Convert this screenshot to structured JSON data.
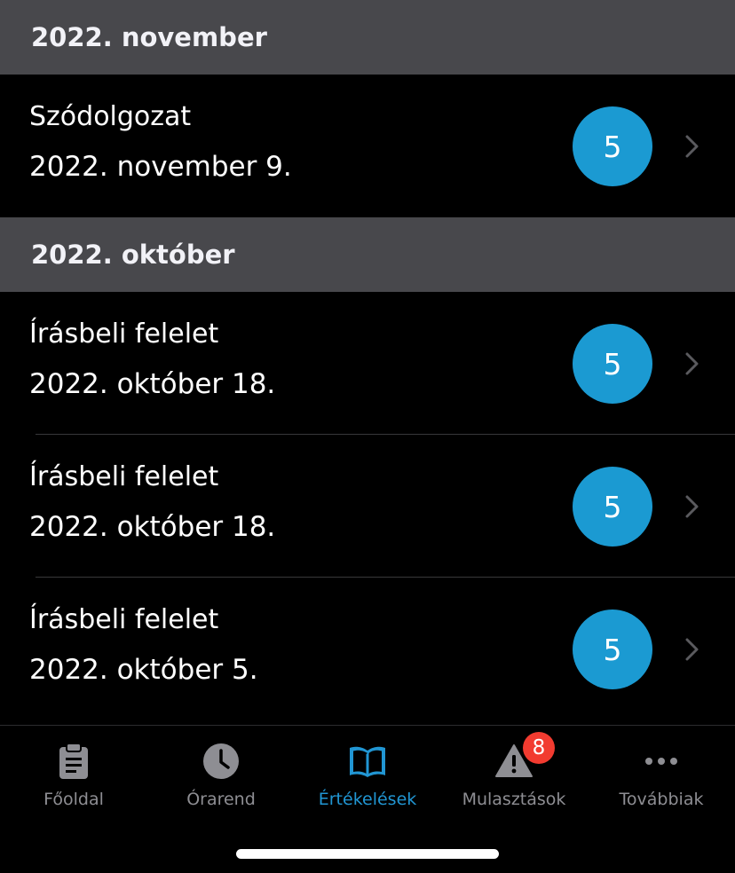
{
  "sections": [
    {
      "header": "2022. november",
      "items": [
        {
          "title": "Szódolgozat",
          "date": "2022. november 9.",
          "grade": "5"
        }
      ]
    },
    {
      "header": "2022. október",
      "items": [
        {
          "title": "Írásbeli felelet",
          "date": "2022. október 18.",
          "grade": "5"
        },
        {
          "title": "Írásbeli felelet",
          "date": "2022. október 18.",
          "grade": "5"
        },
        {
          "title": "Írásbeli felelet",
          "date": "2022. október 5.",
          "grade": "5"
        }
      ]
    }
  ],
  "tabbar": {
    "tabs": [
      {
        "label": "Főoldal",
        "icon": "clipboard-icon",
        "active": false
      },
      {
        "label": "Órarend",
        "icon": "clock-icon",
        "active": false
      },
      {
        "label": "Értékelések",
        "icon": "book-icon",
        "active": true
      },
      {
        "label": "Mulasztások",
        "icon": "warning-icon",
        "active": false,
        "badge": "8"
      },
      {
        "label": "Továbbiak",
        "icon": "more-icon",
        "active": false
      }
    ]
  },
  "colors": {
    "accent": "#2196d3",
    "grade_circle": "#1b9ad2",
    "badge": "#f23b30",
    "section_header_bg": "#48484c",
    "inactive": "#8e8e93"
  }
}
